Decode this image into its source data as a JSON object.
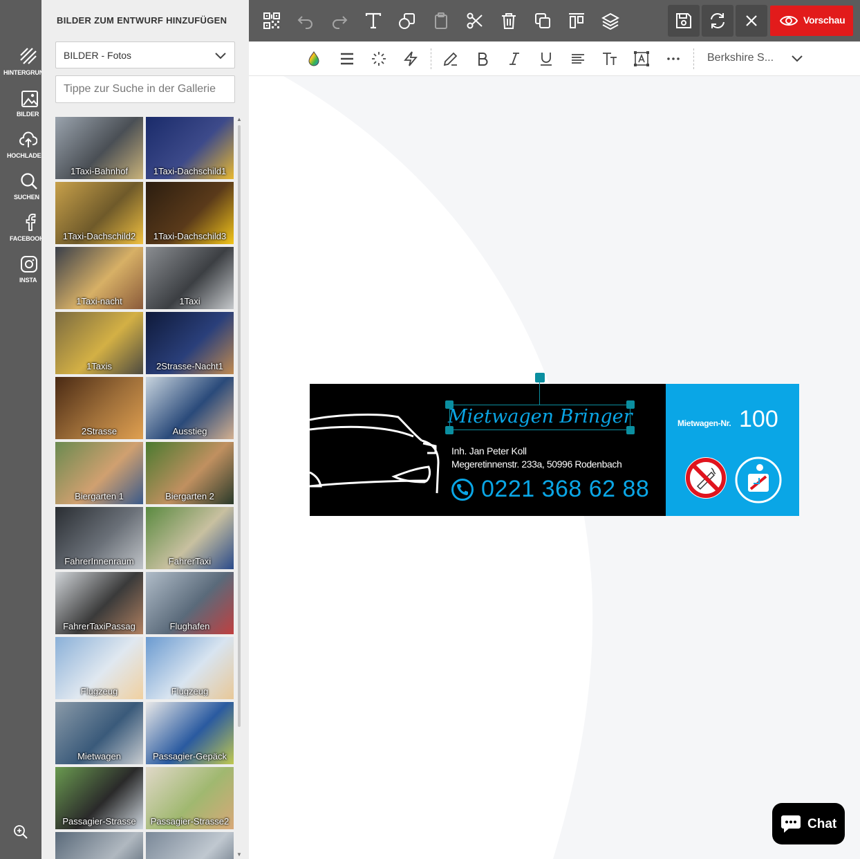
{
  "rail": {
    "items": [
      {
        "label": "HINTERGRUND",
        "icon": "background-icon"
      },
      {
        "label": "BILDER",
        "icon": "image-icon"
      },
      {
        "label": "HOCHLADEN",
        "icon": "upload-icon"
      },
      {
        "label": "SUCHEN",
        "icon": "search-icon"
      },
      {
        "label": "FACEBOOK",
        "icon": "facebook-icon"
      },
      {
        "label": "INSTA",
        "icon": "instagram-icon"
      }
    ],
    "zoom_icon": "zoom-in-icon"
  },
  "panel": {
    "title": "BILDER ZUM ENTWURF HINZUFÜGEN",
    "category": "BILDER - Fotos",
    "search_placeholder": "Tippe zur Suche in der Gallerie",
    "gallery": [
      {
        "label": "1Taxi-Bahnhof",
        "colors": [
          "#9aa3ad",
          "#4a4f55",
          "#c9b27a"
        ]
      },
      {
        "label": "1Taxi-Dachschild1",
        "colors": [
          "#1a2b6a",
          "#3d4a8a",
          "#e8b830"
        ]
      },
      {
        "label": "1Taxi-Dachschild2",
        "colors": [
          "#c7a04a",
          "#6f5a2a",
          "#f0c040"
        ]
      },
      {
        "label": "1Taxi-Dachschild3",
        "colors": [
          "#2b1d10",
          "#5a3a1a",
          "#f2c51a"
        ]
      },
      {
        "label": "1Taxi-nacht",
        "colors": [
          "#3a3f4a",
          "#d7b066",
          "#8a5a3a"
        ]
      },
      {
        "label": "1Taxi",
        "colors": [
          "#8a8d91",
          "#3c3f43",
          "#c5c8cb"
        ]
      },
      {
        "label": "1Taxis",
        "colors": [
          "#7a6a40",
          "#d3b045",
          "#4d4a40"
        ]
      },
      {
        "label": "2Strasse-Nacht1",
        "colors": [
          "#0f1a3a",
          "#2a3f7a",
          "#c08a50"
        ]
      },
      {
        "label": "2Strasse",
        "colors": [
          "#4a2a14",
          "#a0703a",
          "#e0a050"
        ]
      },
      {
        "label": "Ausstieg",
        "colors": [
          "#c8d4de",
          "#2a4a7a",
          "#d4b090"
        ]
      },
      {
        "label": "Biergarten 1",
        "colors": [
          "#6a8a50",
          "#d0a070",
          "#3a5a8a"
        ]
      },
      {
        "label": "Biergarten 2",
        "colors": [
          "#4a7a30",
          "#c09060",
          "#2a3a2a"
        ]
      },
      {
        "label": "FahrerInnenraum",
        "colors": [
          "#2a2e33",
          "#6a7078",
          "#c0c4c8"
        ]
      },
      {
        "label": "FahrerTaxi",
        "colors": [
          "#5a8a40",
          "#c8c0a0",
          "#2a4a8a"
        ]
      },
      {
        "label": "FahrerTaxiPassag",
        "colors": [
          "#d0d4d8",
          "#3a3a3a",
          "#b08060"
        ]
      },
      {
        "label": "Flughafen",
        "colors": [
          "#b0bcc8",
          "#5a6a7a",
          "#c04040"
        ]
      },
      {
        "label": "Flugzeug",
        "colors": [
          "#8ab0d8",
          "#e0e8f0",
          "#f0d0a0"
        ]
      },
      {
        "label": "Flugzeug",
        "colors": [
          "#6a9ad0",
          "#d8e4f0",
          "#e8c898"
        ]
      },
      {
        "label": "Mietwagen",
        "colors": [
          "#8a9aa8",
          "#3a5a7a",
          "#c8ccd0"
        ]
      },
      {
        "label": "Passagier-Gepäck",
        "colors": [
          "#e8e8e8",
          "#2a5aa0",
          "#c0c850"
        ]
      },
      {
        "label": "Passagier-Strasse",
        "colors": [
          "#6a9a50",
          "#2a2a2a",
          "#d0d8e0"
        ]
      },
      {
        "label": "Passagier-Strasse2",
        "colors": [
          "#e0d8c8",
          "#a0b870",
          "#d8a878"
        ]
      },
      {
        "label": "",
        "colors": [
          "#5a6a7a",
          "#b0b8c0",
          "#3a4a5a"
        ]
      },
      {
        "label": "",
        "colors": [
          "#7a8898",
          "#c0c8d0",
          "#4a5868"
        ]
      }
    ]
  },
  "toolbar": {
    "buttons": [
      "qr-code-icon",
      "undo-icon",
      "redo-icon",
      "text-icon",
      "shape-icon",
      "paste-icon",
      "cut-icon",
      "delete-icon",
      "duplicate-icon",
      "align-icon",
      "layers-icon"
    ],
    "preview_label": "Vorschau"
  },
  "formatbar": {
    "font_name": "Berkshire S..."
  },
  "design": {
    "title": "Mietwagen Bringer",
    "owner": "Inh. Jan Peter Koll",
    "address": "Megeretinnenstr. 233a, 50996 Rodenbach",
    "phone": "0221 368 62 88",
    "nr_label": "Mietwagen-Nr.",
    "nr_value": "100",
    "colors": {
      "background": "#000000",
      "accent": "#0aa6e6",
      "text": "#ffffff"
    }
  },
  "chat": {
    "label": "Chat"
  },
  "colors": {
    "rail": "#5c5c5c",
    "panel": "#eeeeee",
    "preview": "#e21b1b",
    "selection": "#0b8fa0"
  }
}
